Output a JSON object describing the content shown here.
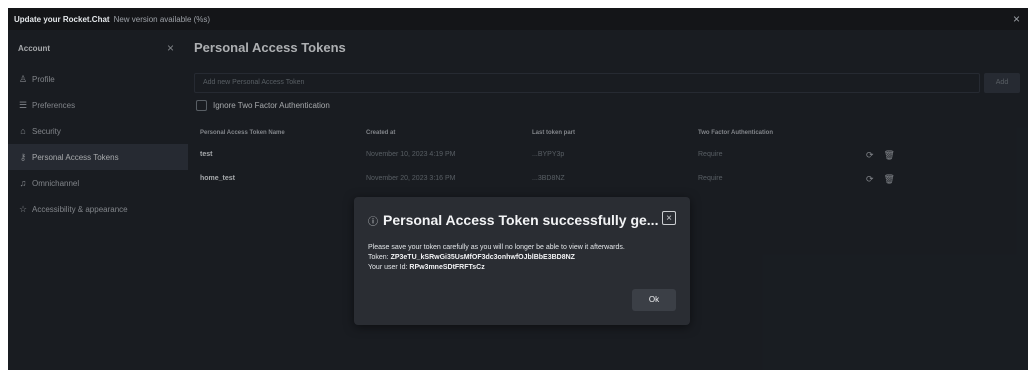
{
  "banner": {
    "title": "Update your Rocket.Chat",
    "message": "New version available (%s)",
    "close": "×"
  },
  "sidebar": {
    "title": "Account",
    "close": "×",
    "items": [
      {
        "label": "Profile",
        "icon": "user-icon",
        "glyph": "♙"
      },
      {
        "label": "Preferences",
        "icon": "sliders-icon",
        "glyph": "☰"
      },
      {
        "label": "Security",
        "icon": "lock-icon",
        "glyph": "⌂"
      },
      {
        "label": "Personal Access Tokens",
        "icon": "key-icon",
        "glyph": "⚷"
      },
      {
        "label": "Omnichannel",
        "icon": "headset-icon",
        "glyph": "♫"
      },
      {
        "label": "Accessibility & appearance",
        "icon": "star-icon",
        "glyph": "☆"
      }
    ],
    "active_index": 3
  },
  "main": {
    "title": "Personal Access Tokens",
    "input_placeholder": "Add new Personal Access Token",
    "add_label": "Add",
    "tfa_label": "Ignore Two Factor Authentication",
    "columns": [
      "Personal Access Token Name",
      "Created at",
      "Last token part",
      "Two Factor Authentication"
    ],
    "rows": [
      {
        "name": "test",
        "created": "November 10, 2023 4:19 PM",
        "last": "...BYPY3p",
        "tfa": "Require"
      },
      {
        "name": "home_test",
        "created": "November 20, 2023 3:16 PM",
        "last": "...3BD8NZ",
        "tfa": "Require"
      }
    ]
  },
  "modal": {
    "title": "Personal Access Token successfully ge...",
    "message": "Please save your token carefully as you will no longer be able to view it afterwards.",
    "token_label": "Token:",
    "token_value": "ZP3eTU_kSRwGi35UsMfOF3dc3onhwfOJblBbE3BD8NZ",
    "user_label": "Your user Id:",
    "user_value": "RPw3mneSDtFRFTsCz",
    "ok_label": "Ok"
  }
}
